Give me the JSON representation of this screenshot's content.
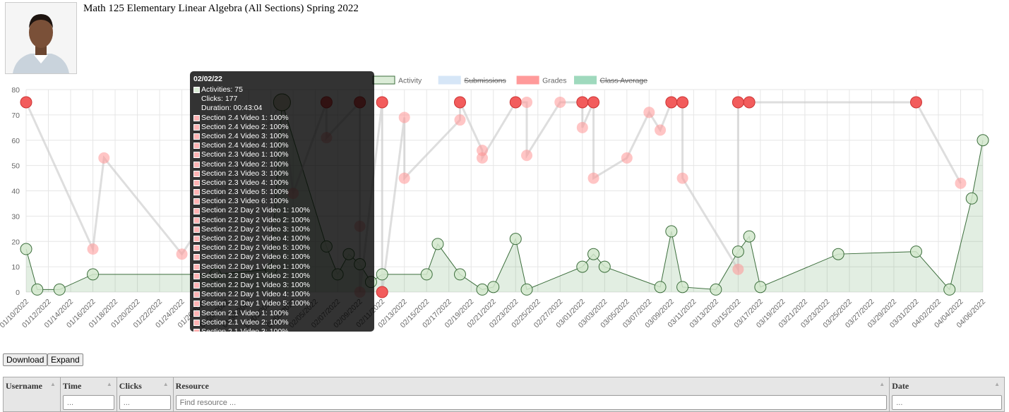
{
  "header": {
    "title": "Math 125 Elementary Linear Algebra (All Sections) Spring 2022"
  },
  "chart_data": {
    "type": "line",
    "legend": [
      "Activity",
      "Submissions",
      "Grades",
      "Class Average"
    ],
    "legend_hidden": [
      "Submissions",
      "Class Average"
    ],
    "legend_position": "top",
    "colors": {
      "Activity": "#dbecd7",
      "Submissions": "#d6e6f7",
      "Grades": "#ff9a9a",
      "Class Average": "#9fd9bd"
    },
    "ylim": [
      0,
      80
    ],
    "yticks": [
      0,
      10,
      20,
      30,
      40,
      50,
      60,
      70,
      80
    ],
    "xlim": [
      "2022-01-10",
      "2022-04-06"
    ],
    "xticks": [
      "01/10/2022",
      "01/12/2022",
      "01/14/2022",
      "01/16/2022",
      "01/18/2022",
      "01/20/2022",
      "01/22/2022",
      "01/24/2022",
      "01/26/2022",
      "01/28/2022",
      "01/30/2022",
      "02/01/2022",
      "02/03/2022",
      "02/05/2022",
      "02/07/2022",
      "02/09/2022",
      "02/11/2022",
      "02/13/2022",
      "02/15/2022",
      "02/17/2022",
      "02/19/2022",
      "02/21/2022",
      "02/23/2022",
      "02/25/2022",
      "02/27/2022",
      "03/01/2022",
      "03/03/2022",
      "03/05/2022",
      "03/07/2022",
      "03/09/2022",
      "03/11/2022",
      "03/13/2022",
      "03/15/2022",
      "03/17/2022",
      "03/19/2022",
      "03/21/2022",
      "03/23/2022",
      "03/25/2022",
      "03/27/2022",
      "03/29/2022",
      "03/31/2022",
      "04/02/2022",
      "04/04/2022",
      "04/06/2022"
    ],
    "grid": true,
    "series": [
      {
        "name": "Activity",
        "points": [
          [
            "2022-01-10",
            17
          ],
          [
            "2022-01-11",
            1
          ],
          [
            "2022-01-13",
            1
          ],
          [
            "2022-01-16",
            7
          ],
          [
            "2022-01-27",
            7
          ],
          [
            "2022-02-01",
            9
          ],
          [
            "2022-02-02",
            75
          ],
          [
            "2022-02-06",
            18
          ],
          [
            "2022-02-07",
            7
          ],
          [
            "2022-02-08",
            15
          ],
          [
            "2022-02-09",
            11
          ],
          [
            "2022-02-10",
            4
          ],
          [
            "2022-02-11",
            7
          ],
          [
            "2022-02-15",
            7
          ],
          [
            "2022-02-16",
            19
          ],
          [
            "2022-02-18",
            7
          ],
          [
            "2022-02-20",
            1
          ],
          [
            "2022-02-21",
            2
          ],
          [
            "2022-02-23",
            21
          ],
          [
            "2022-02-24",
            1
          ],
          [
            "2022-03-01",
            10
          ],
          [
            "2022-03-02",
            15
          ],
          [
            "2022-03-03",
            10
          ],
          [
            "2022-03-08",
            2
          ],
          [
            "2022-03-09",
            24
          ],
          [
            "2022-03-10",
            2
          ],
          [
            "2022-03-13",
            1
          ],
          [
            "2022-03-15",
            16
          ],
          [
            "2022-03-16",
            22
          ],
          [
            "2022-03-17",
            2
          ],
          [
            "2022-03-24",
            15
          ],
          [
            "2022-03-31",
            16
          ],
          [
            "2022-04-03",
            1
          ],
          [
            "2022-04-05",
            37
          ],
          [
            "2022-04-06",
            60
          ]
        ]
      },
      {
        "name": "Grades",
        "points": [
          [
            "2022-01-10",
            75,
            1
          ],
          [
            "2022-01-16",
            17,
            0
          ],
          [
            "2022-01-17",
            53,
            0
          ],
          [
            "2022-01-24",
            15,
            0
          ],
          [
            "2022-02-02",
            75,
            1
          ],
          [
            "2022-02-03",
            39,
            0
          ],
          [
            "2022-02-06",
            75,
            1
          ],
          [
            "2022-02-06",
            61,
            0
          ],
          [
            "2022-02-09",
            75,
            1
          ],
          [
            "2022-02-09",
            26,
            0
          ],
          [
            "2022-02-09",
            0,
            0
          ],
          [
            "2022-02-11",
            75,
            1
          ],
          [
            "2022-02-11",
            0,
            1
          ],
          [
            "2022-02-13",
            69,
            0
          ],
          [
            "2022-02-13",
            45,
            0
          ],
          [
            "2022-02-18",
            68,
            0
          ],
          [
            "2022-02-18",
            75,
            1
          ],
          [
            "2022-02-20",
            56,
            0
          ],
          [
            "2022-02-20",
            53,
            0
          ],
          [
            "2022-02-23",
            75,
            1
          ],
          [
            "2022-02-24",
            75,
            0
          ],
          [
            "2022-02-24",
            54,
            0
          ],
          [
            "2022-02-27",
            75,
            0
          ],
          [
            "2022-03-01",
            75,
            1
          ],
          [
            "2022-03-01",
            65,
            0
          ],
          [
            "2022-03-02",
            75,
            1
          ],
          [
            "2022-03-02",
            45,
            0
          ],
          [
            "2022-03-05",
            53,
            0
          ],
          [
            "2022-03-07",
            71,
            0
          ],
          [
            "2022-03-08",
            64,
            0
          ],
          [
            "2022-03-09",
            75,
            1
          ],
          [
            "2022-03-10",
            75,
            1
          ],
          [
            "2022-03-10",
            45,
            0
          ],
          [
            "2022-03-15",
            9,
            0
          ],
          [
            "2022-03-15",
            75,
            1
          ],
          [
            "2022-03-16",
            75,
            1
          ],
          [
            "2022-03-31",
            75,
            1
          ],
          [
            "2022-04-04",
            43,
            0
          ]
        ]
      }
    ],
    "hovered": "2022-02-02"
  },
  "tooltip": {
    "title": "02/02/22",
    "activities": "Activities: 75",
    "clicks": "Clicks: 177",
    "duration": "Duration: 00:43:04",
    "items": [
      "Section 2.4 Video 1: 100%",
      "Section 2.4 Video 2: 100%",
      "Section 2.4 Video 3: 100%",
      "Section 2.4 Video 4: 100%",
      "Section 2.3 Video 1: 100%",
      "Section 2.3 Video 2: 100%",
      "Section 2.3 Video 3: 100%",
      "Section 2.3 Video 4: 100%",
      "Section 2.3 Video 5: 100%",
      "Section 2.3 Video 6: 100%",
      "Section 2.2 Day 2 Video 1: 100%",
      "Section 2.2 Day 2 Video 2: 100%",
      "Section 2.2 Day 2 Video 3: 100%",
      "Section 2.2 Day 2 Video 4: 100%",
      "Section 2.2 Day 2 Video 5: 100%",
      "Section 2.2 Day 2 Video 6: 100%",
      "Section 2.2 Day 1 Video 1: 100%",
      "Section 2.2 Day 1 Video 2: 100%",
      "Section 2.2 Day 1 Video 3: 100%",
      "Section 2.2 Day 1 Video 4: 100%",
      "Section 2.2 Day 1 Video 5: 100%",
      "Section 2.1 Video 1: 100%",
      "Section 2.1 Video 2: 100%",
      "Section 2.1 Video 3: 100%"
    ]
  },
  "buttons": {
    "download": "Download",
    "expand": "Expand"
  },
  "table": {
    "columns": [
      {
        "label": "Username",
        "placeholder": null
      },
      {
        "label": "Time",
        "placeholder": "..."
      },
      {
        "label": "Clicks",
        "placeholder": "..."
      },
      {
        "label": "Resource",
        "placeholder": "Find resource ..."
      },
      {
        "label": "Date",
        "placeholder": "..."
      }
    ]
  }
}
